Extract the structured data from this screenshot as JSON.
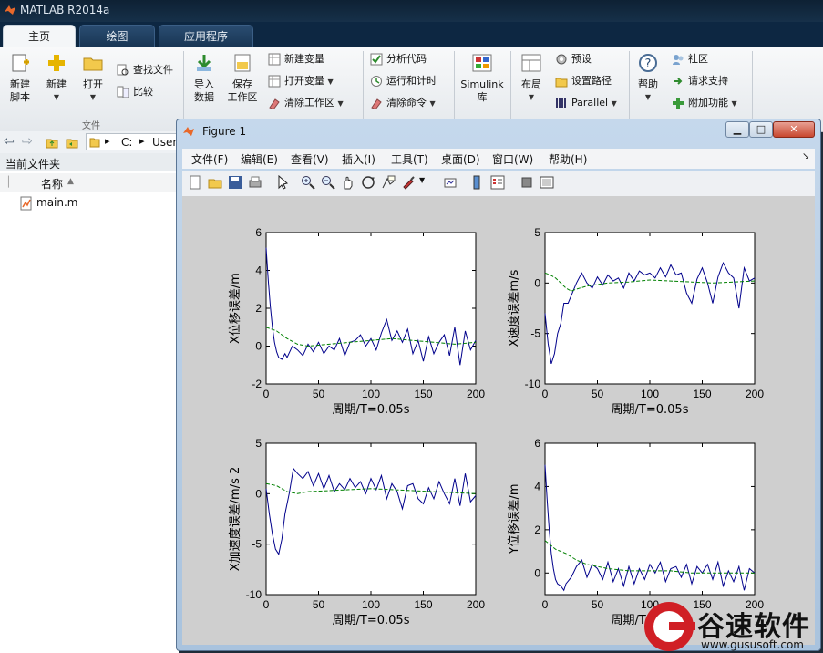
{
  "app": {
    "title": "MATLAB R2014a"
  },
  "tabs": [
    "主页",
    "绘图",
    "应用程序"
  ],
  "ribbon": {
    "new_script": "新建\n脚本",
    "new": "新建",
    "open": "打开",
    "find_files": "查找文件",
    "compare": "比较",
    "file_group": "文件",
    "import_data": "导入\n数据",
    "save_workspace": "保存\n工作区",
    "new_variable": "新建变量",
    "open_variable": "打开变量",
    "clear_workspace": "清除工作区",
    "analyze_code": "分析代码",
    "run_and_time": "运行和计时",
    "clear_commands": "清除命令",
    "simulink": "Simulink\n库",
    "layout": "布局",
    "preferences": "预设",
    "set_path": "设置路径",
    "parallel": "Parallel",
    "help": "帮助",
    "community": "社区",
    "request_support": "请求支持",
    "add_ons": "附加功能"
  },
  "browser": {
    "path_drive": "C:",
    "path_rest": "User",
    "current_folder": "当前文件夹",
    "col_name": "名称",
    "files": [
      "main.m"
    ]
  },
  "figure": {
    "title": "Figure 1",
    "menus": [
      "文件(F)",
      "编辑(E)",
      "查看(V)",
      "插入(I)",
      "工具(T)",
      "桌面(D)",
      "窗口(W)",
      "帮助(H)"
    ]
  },
  "watermark": {
    "brand": "谷速软件",
    "url": "www.gususoft.com"
  },
  "colors": {
    "accent": "#0d2742",
    "series_main": "#00008b",
    "series_est": "#008000",
    "plot_bg": "#cfcfcf"
  },
  "chart_data": [
    {
      "type": "line",
      "title": "",
      "xlabel": "周期/T=0.05s",
      "ylabel": "X位移误差/m",
      "xlim": [
        0,
        200
      ],
      "ylim": [
        -2,
        6
      ],
      "xticks": [
        0,
        50,
        100,
        150,
        200
      ],
      "yticks": [
        -2,
        0,
        2,
        4,
        6
      ],
      "series": [
        {
          "style": "solid",
          "color": "#00008b",
          "x": [
            0,
            2,
            4,
            6,
            8,
            10,
            12,
            15,
            18,
            20,
            25,
            30,
            35,
            40,
            45,
            50,
            55,
            60,
            65,
            70,
            75,
            80,
            85,
            90,
            95,
            100,
            105,
            110,
            115,
            120,
            125,
            130,
            135,
            140,
            145,
            150,
            155,
            160,
            165,
            170,
            175,
            180,
            185,
            190,
            195,
            200
          ],
          "y": [
            5.2,
            3.5,
            2.1,
            1.0,
            0.2,
            -0.3,
            -0.6,
            -0.7,
            -0.4,
            -0.6,
            0.0,
            -0.2,
            -0.5,
            0.1,
            -0.3,
            0.2,
            -0.4,
            0.0,
            -0.2,
            0.4,
            -0.5,
            0.2,
            0.3,
            0.6,
            0.0,
            0.4,
            -0.2,
            0.7,
            1.4,
            0.3,
            0.8,
            0.2,
            0.9,
            -0.4,
            0.3,
            -0.8,
            0.5,
            -0.4,
            0.2,
            0.6,
            -0.5,
            1.0,
            -1.0,
            0.8,
            -0.2,
            0.3
          ]
        },
        {
          "style": "dashed",
          "color": "#008000",
          "x": [
            0,
            5,
            10,
            15,
            20,
            30,
            40,
            60,
            80,
            100,
            120,
            140,
            160,
            180,
            200
          ],
          "y": [
            1.0,
            0.9,
            0.8,
            0.6,
            0.4,
            0.1,
            0.0,
            0.1,
            0.2,
            0.3,
            0.4,
            0.3,
            0.2,
            0.1,
            0.2
          ]
        }
      ]
    },
    {
      "type": "line",
      "title": "",
      "xlabel": "周期/T=0.05s",
      "ylabel": "X速度误差m/s",
      "xlim": [
        0,
        200
      ],
      "ylim": [
        -10,
        5
      ],
      "xticks": [
        0,
        50,
        100,
        150,
        200
      ],
      "yticks": [
        -10,
        -5,
        0,
        5
      ],
      "series": [
        {
          "style": "solid",
          "color": "#00008b",
          "x": [
            0,
            3,
            6,
            9,
            12,
            15,
            18,
            22,
            26,
            30,
            35,
            40,
            45,
            50,
            55,
            60,
            65,
            70,
            75,
            80,
            85,
            90,
            95,
            100,
            105,
            110,
            115,
            120,
            125,
            130,
            135,
            140,
            145,
            150,
            155,
            160,
            165,
            170,
            175,
            180,
            185,
            190,
            195,
            200
          ],
          "y": [
            -3,
            -6,
            -8,
            -7,
            -5,
            -4,
            -2,
            -2,
            -1,
            0,
            1,
            0,
            -0.5,
            0.6,
            -0.2,
            0.8,
            0.2,
            0.5,
            -0.5,
            1.0,
            0.2,
            1.2,
            0.8,
            1.0,
            0.5,
            1.5,
            0.6,
            1.8,
            0.8,
            1.0,
            -1.0,
            -2.0,
            0.4,
            1.5,
            0.0,
            -2.0,
            0.6,
            2.0,
            1.0,
            0.5,
            -2.5,
            1.5,
            0.2,
            0.5
          ]
        },
        {
          "style": "dashed",
          "color": "#008000",
          "x": [
            0,
            5,
            10,
            15,
            20,
            25,
            30,
            40,
            60,
            80,
            100,
            120,
            140,
            160,
            180,
            200
          ],
          "y": [
            1.0,
            0.8,
            0.5,
            0.0,
            -0.5,
            -0.8,
            -0.6,
            -0.3,
            0.0,
            0.1,
            0.3,
            0.2,
            0.1,
            0.0,
            0.1,
            0.2
          ]
        }
      ]
    },
    {
      "type": "line",
      "title": "",
      "xlabel": "周期/T=0.05s",
      "ylabel": "X加速度误差/m/s 2",
      "xlim": [
        0,
        200
      ],
      "ylim": [
        -10,
        5
      ],
      "xticks": [
        0,
        50,
        100,
        150,
        200
      ],
      "yticks": [
        -10,
        -5,
        0,
        5
      ],
      "series": [
        {
          "style": "solid",
          "color": "#00008b",
          "x": [
            0,
            3,
            6,
            9,
            12,
            15,
            18,
            22,
            26,
            30,
            35,
            40,
            45,
            50,
            55,
            60,
            65,
            70,
            75,
            80,
            85,
            90,
            95,
            100,
            105,
            110,
            115,
            120,
            125,
            130,
            135,
            140,
            145,
            150,
            155,
            160,
            165,
            170,
            175,
            180,
            185,
            190,
            195,
            200
          ],
          "y": [
            0.5,
            -2,
            -4,
            -5.5,
            -6,
            -4.5,
            -2,
            0,
            2.5,
            2,
            1.5,
            2.2,
            0.8,
            2.0,
            0.5,
            1.8,
            0.2,
            1.0,
            0.4,
            1.5,
            0.6,
            1.2,
            0.0,
            1.5,
            0.4,
            1.8,
            -0.5,
            1.0,
            0.2,
            -1.5,
            0.8,
            1.0,
            -0.5,
            -1.0,
            0.6,
            -0.5,
            1.2,
            0.0,
            -1.0,
            1.5,
            -1.2,
            2.0,
            -0.8,
            -0.2
          ]
        },
        {
          "style": "dashed",
          "color": "#008000",
          "x": [
            0,
            10,
            20,
            30,
            40,
            60,
            80,
            100,
            120,
            140,
            160,
            180,
            200
          ],
          "y": [
            1.0,
            0.8,
            0.2,
            0.0,
            0.2,
            0.3,
            0.4,
            0.5,
            0.4,
            0.3,
            0.2,
            0.1,
            0.0
          ]
        }
      ]
    },
    {
      "type": "line",
      "title": "",
      "xlabel": "周期/T=0.05s",
      "ylabel": "Y位移误差/m",
      "xlim": [
        0,
        200
      ],
      "ylim": [
        -1,
        6
      ],
      "xticks": [
        0,
        50,
        100,
        150,
        200
      ],
      "yticks": [
        0,
        2,
        4,
        6
      ],
      "series": [
        {
          "style": "solid",
          "color": "#00008b",
          "x": [
            0,
            2,
            4,
            6,
            8,
            10,
            12,
            15,
            18,
            20,
            25,
            30,
            35,
            40,
            45,
            50,
            55,
            60,
            65,
            70,
            75,
            80,
            85,
            90,
            95,
            100,
            105,
            110,
            115,
            120,
            125,
            130,
            135,
            140,
            145,
            150,
            155,
            160,
            165,
            170,
            175,
            180,
            185,
            190,
            195,
            200
          ],
          "y": [
            5.0,
            3.4,
            2.0,
            0.9,
            0.2,
            -0.3,
            -0.5,
            -0.6,
            -0.8,
            -0.5,
            -0.2,
            0.3,
            0.6,
            -0.2,
            0.4,
            0.2,
            -0.3,
            0.5,
            -0.4,
            0.2,
            -0.6,
            0.3,
            -0.5,
            0.2,
            -0.3,
            0.4,
            0.0,
            0.5,
            -0.4,
            0.2,
            0.3,
            -0.2,
            0.4,
            -0.5,
            0.3,
            0.0,
            0.4,
            -0.3,
            0.5,
            -0.6,
            0.1,
            -0.4,
            0.3,
            -0.8,
            0.2,
            0.0
          ]
        },
        {
          "style": "dashed",
          "color": "#008000",
          "x": [
            0,
            5,
            10,
            15,
            20,
            30,
            40,
            60,
            80,
            100,
            120,
            140,
            160,
            180,
            200
          ],
          "y": [
            1.5,
            1.3,
            1.1,
            1.0,
            0.9,
            0.6,
            0.4,
            0.2,
            0.1,
            0.1,
            0.1,
            0.0,
            0.0,
            0.0,
            0.0
          ]
        }
      ]
    }
  ]
}
